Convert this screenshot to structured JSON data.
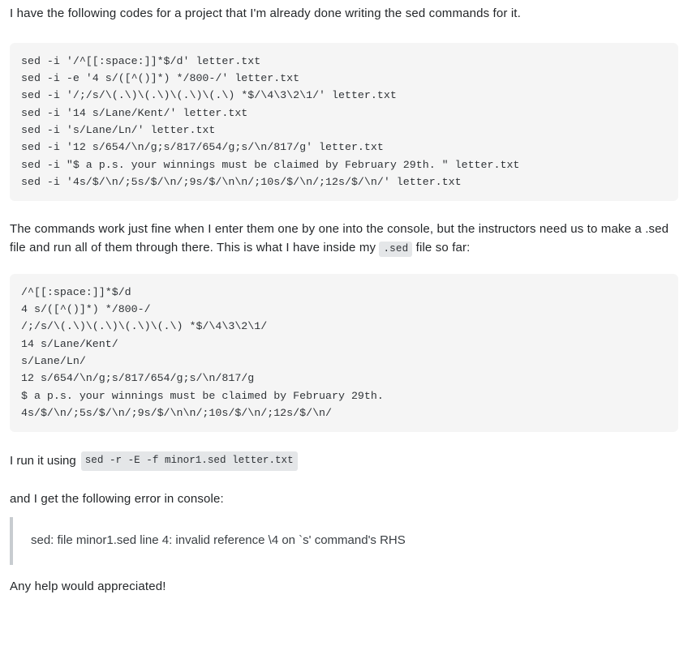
{
  "post": {
    "intro_paragraph": "I have the following codes for a project that I'm already done writing the sed commands for it.",
    "code_block_commands": "sed -i '/^[[:space:]]*$/d' letter.txt\nsed -i -e '4 s/([^()]*) */800-/' letter.txt\nsed -i '/;/s/\\(.\\)\\(.\\)\\(.\\)\\(.\\) *$/\\4\\3\\2\\1/' letter.txt\nsed -i '14 s/Lane/Kent/' letter.txt\nsed -i 's/Lane/Ln/' letter.txt\nsed -i '12 s/654/\\n/g;s/817/654/g;s/\\n/817/g' letter.txt\nsed -i \"$ a p.s. your winnings must be claimed by February 29th. \" letter.txt\nsed -i '4s/$/\\n/;5s/$/\\n/;9s/$/\\n\\n/;10s/$/\\n/;12s/$/\\n/' letter.txt",
    "middle_paragraph_part1": "The commands work just fine when I enter them one by one into the console, but the instructors need us to make a .sed file and run all of them through there. This is what I have inside my",
    "middle_paragraph_inline_code": ".sed",
    "middle_paragraph_part2": "file so far:",
    "code_block_sedfile": "/^[[:space:]]*$/d\n4 s/([^()]*) */800-/\n/;/s/\\(.\\)\\(.\\)\\(.\\)\\(.\\) *$/\\4\\3\\2\\1/\n14 s/Lane/Kent/\ns/Lane/Ln/\n12 s/654/\\n/g;s/817/654/g;s/\\n/817/g\n$ a p.s. your winnings must be claimed by February 29th.\n4s/$/\\n/;5s/$/\\n/;9s/$/\\n\\n/;10s/$/\\n/;12s/$/\\n/",
    "run_line_prefix": "I run it using",
    "run_command": "sed -r -E -f minor1.sed letter.txt",
    "error_intro": "and I get the following error in console:",
    "error_message": "sed: file minor1.sed line 4: invalid reference \\4 on `s' command's RHS",
    "closing_paragraph": "Any help would appreciated!"
  },
  "colors": {
    "code_background": "#f5f5f5",
    "inline_code_background": "#e4e6e8",
    "text": "#232629",
    "quote_border": "#c8ccd0"
  }
}
